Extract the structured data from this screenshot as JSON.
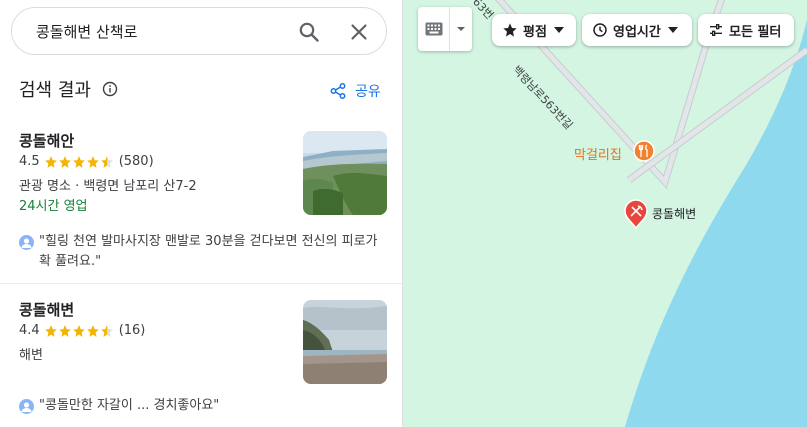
{
  "search": {
    "query": "콩돌해변 산책로"
  },
  "results_header": {
    "title": "검색 결과",
    "share_label": "공유"
  },
  "results": [
    {
      "name": "콩돌해안",
      "rating": "4.5",
      "stars": 4.5,
      "reviews": "(580)",
      "category_address": "관광 명소 · 백령면 남포리 산7-2",
      "hours": "24시간 영업",
      "review_snippet": "\"힐링 천연 발마사지장 맨발로 30분을 걷다보면 전신의 피로가 확 풀려요.\""
    },
    {
      "name": "콩돌해변",
      "rating": "4.4",
      "stars": 4.5,
      "reviews": "(16)",
      "category_address": "해변",
      "review_snippet": "\"콩돌만한 자갈이 ... 경치좋아요\""
    }
  ],
  "map": {
    "filters": {
      "rating": "평점",
      "hours": "영업시간",
      "all": "모든 필터"
    },
    "road_label": "백령남로563번길",
    "road_label_partial": "63번",
    "places": {
      "restaurant": "막걸리집",
      "beach": "콩돌해변"
    },
    "colors": {
      "land": "#d4f5e2",
      "water": "#8fd9ef",
      "road": "#d0d4d6",
      "food_pin": "#f2802c",
      "beach_pin": "#e8453c",
      "star": "#f4b400",
      "link": "#1a73e8",
      "open_green": "#188038"
    }
  },
  "icons": [
    "search-icon",
    "close-icon",
    "info-icon",
    "share-icon",
    "keyboard-icon",
    "star-icon",
    "clock-icon",
    "sliders-icon",
    "restaurant-pin-icon",
    "beach-pin-icon"
  ]
}
